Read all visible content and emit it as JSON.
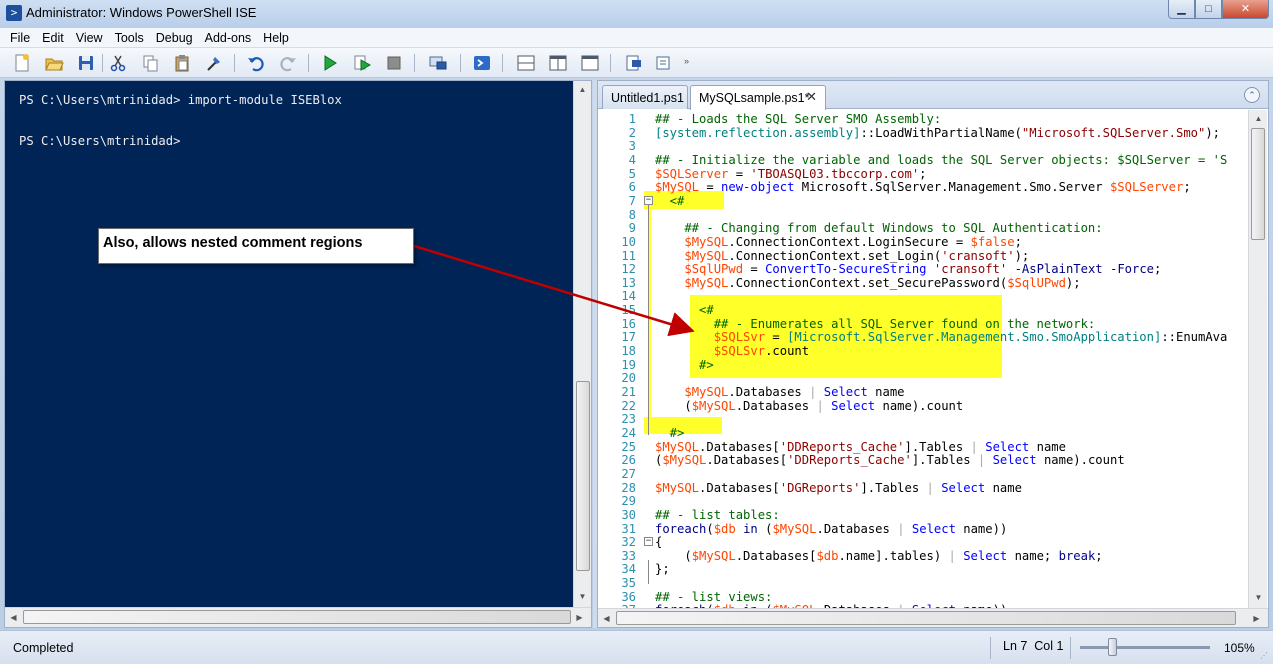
{
  "window": {
    "title": "Administrator: Windows PowerShell ISE",
    "minimize_label": "▁",
    "maximize_label": "□",
    "close_label": "✕"
  },
  "menu": [
    "File",
    "Edit",
    "View",
    "Tools",
    "Debug",
    "Add-ons",
    "Help"
  ],
  "toolbar_icons": [
    "new-file-icon",
    "open-file-icon",
    "save-icon",
    "cut-icon",
    "copy-icon",
    "paste-icon",
    "clear-console-icon",
    "undo-icon",
    "redo-icon",
    "run-icon",
    "run-selection-icon",
    "stop-icon",
    "remote-powershell-icon",
    "powershell-icon",
    "layout-top-icon",
    "layout-right-icon",
    "layout-max-icon",
    "show-command-icon",
    "toolbar-overflow-icon"
  ],
  "console": {
    "lines": [
      "PS C:\\Users\\mtrinidad> import-module ISEBlox",
      "PS C:\\Users\\mtrinidad>"
    ],
    "background": "#012456"
  },
  "tabs": [
    {
      "label": "Untitled1.ps1",
      "active": false
    },
    {
      "label": "MySQLsample.ps1*",
      "active": true
    }
  ],
  "tab_close_label": "✕",
  "collapse_label": "⌃",
  "editor": {
    "lines": [
      {
        "n": "1",
        "text": "## - Loads the SQL Server SMO Assembly:"
      },
      {
        "n": "2",
        "text": "[system.reflection.assembly]::LoadWithPartialName(\"Microsoft.SQLServer.Smo\");"
      },
      {
        "n": "3",
        "text": ""
      },
      {
        "n": "4",
        "text": "## - Initialize the variable and loads the SQL Server objects: $SQLServer = 'S"
      },
      {
        "n": "5",
        "text": "$SQLServer = 'TBOASQL03.tbccorp.com';"
      },
      {
        "n": "6",
        "text": "$MySQL = new-object Microsoft.SqlServer.Management.Smo.Server $SQLServer;"
      },
      {
        "n": "7",
        "text": "  <#"
      },
      {
        "n": "8",
        "text": ""
      },
      {
        "n": "9",
        "text": "    ## - Changing from default Windows to SQL Authentication:"
      },
      {
        "n": "10",
        "text": "    $MySQL.ConnectionContext.LoginSecure = $false;"
      },
      {
        "n": "11",
        "text": "    $MySQL.ConnectionContext.set_Login('cransoft');"
      },
      {
        "n": "12",
        "text": "    $SqlUPwd = ConvertTo-SecureString 'cransoft' -AsPlainText -Force;"
      },
      {
        "n": "13",
        "text": "    $MySQL.ConnectionContext.set_SecurePassword($SqlUPwd);"
      },
      {
        "n": "14",
        "text": ""
      },
      {
        "n": "15",
        "text": "      <#"
      },
      {
        "n": "16",
        "text": "        ## - Enumerates all SQL Server found on the network:"
      },
      {
        "n": "17",
        "text": "        $SQLSvr = [Microsoft.SqlServer.Management.Smo.SmoApplication]::EnumAva"
      },
      {
        "n": "18",
        "text": "        $SQLSvr.count"
      },
      {
        "n": "19",
        "text": "      #>"
      },
      {
        "n": "20",
        "text": ""
      },
      {
        "n": "21",
        "text": "    $MySQL.Databases | Select name"
      },
      {
        "n": "22",
        "text": "    ($MySQL.Databases | Select name).count"
      },
      {
        "n": "23",
        "text": ""
      },
      {
        "n": "24",
        "text": "  #>"
      },
      {
        "n": "25",
        "text": "$MySQL.Databases['DDReports_Cache'].Tables | Select name"
      },
      {
        "n": "26",
        "text": "($MySQL.Databases['DDReports_Cache'].Tables | Select name).count"
      },
      {
        "n": "27",
        "text": ""
      },
      {
        "n": "28",
        "text": "$MySQL.Databases['DGReports'].Tables | Select name"
      },
      {
        "n": "29",
        "text": ""
      },
      {
        "n": "30",
        "text": "## - list tables:"
      },
      {
        "n": "31",
        "text": "foreach($db in ($MySQL.Databases | Select name))"
      },
      {
        "n": "32",
        "text": "{"
      },
      {
        "n": "33",
        "text": "    ($MySQL.Databases[$db.name].tables) | Select name; break;"
      },
      {
        "n": "34",
        "text": "};"
      },
      {
        "n": "35",
        "text": ""
      },
      {
        "n": "36",
        "text": "## - list views:"
      },
      {
        "n": "37",
        "text": "foreach($db in ($MySQL.Databases | Select name))"
      }
    ]
  },
  "callout": "Also, allows nested comment regions",
  "status": {
    "text": "Completed",
    "position": "Ln 7  Col 1",
    "zoom": "105%",
    "zoom_level": 0.25
  }
}
